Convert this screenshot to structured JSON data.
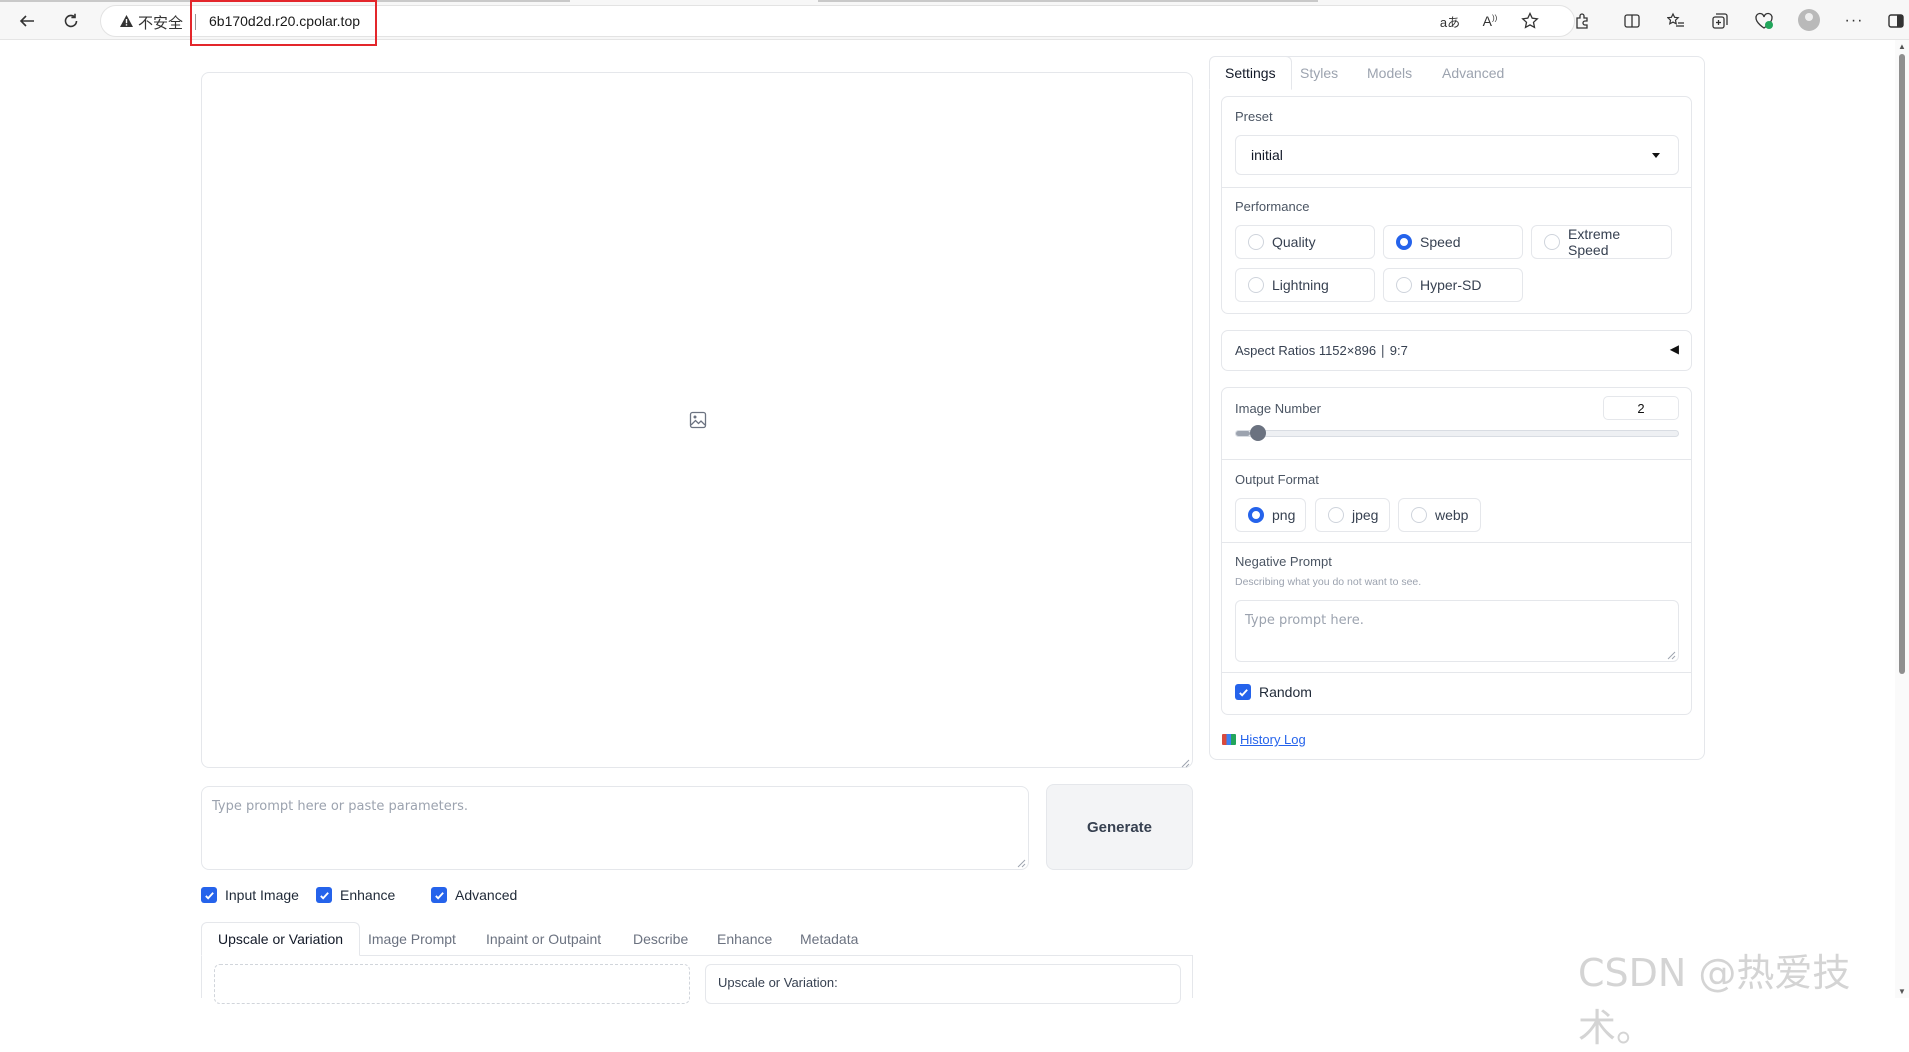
{
  "browser": {
    "security_label": "不安全",
    "url": "6b170d2d.r20.cpolar.top"
  },
  "main": {
    "prompt_placeholder": "Type prompt here or paste parameters.",
    "generate_label": "Generate",
    "checkboxes": [
      {
        "label": "Input Image",
        "checked": true
      },
      {
        "label": "Enhance",
        "checked": true
      },
      {
        "label": "Advanced",
        "checked": true
      }
    ],
    "tabs": [
      "Upscale or Variation",
      "Image Prompt",
      "Inpaint or Outpaint",
      "Describe",
      "Enhance",
      "Metadata"
    ],
    "active_tab": "Upscale or Variation",
    "upscale_label": "Upscale or Variation:"
  },
  "sidebar": {
    "tabs": [
      "Settings",
      "Styles",
      "Models",
      "Advanced"
    ],
    "active_tab": "Settings",
    "preset": {
      "label": "Preset",
      "value": "initial"
    },
    "performance": {
      "label": "Performance",
      "options": [
        "Quality",
        "Speed",
        "Extreme Speed",
        "Lightning",
        "Hyper-SD"
      ],
      "selected": "Speed"
    },
    "aspect_ratios": {
      "label": "Aspect Ratios 1152×896 ∣ 9:7",
      "collapsed_icon": "◀"
    },
    "image_number": {
      "label": "Image Number",
      "value": "2",
      "min": 1,
      "max": 32
    },
    "output_format": {
      "label": "Output Format",
      "options": [
        "png",
        "jpeg",
        "webp"
      ],
      "selected": "png"
    },
    "negative_prompt": {
      "label": "Negative Prompt",
      "hint": "Describing what you do not want to see.",
      "placeholder": "Type prompt here."
    },
    "random": {
      "label": "Random",
      "checked": true
    },
    "history_log": "History Log"
  },
  "watermark": "CSDN @热爱技术。",
  "colors": {
    "accent": "#2563eb",
    "highlight_box": "#e3262b"
  }
}
